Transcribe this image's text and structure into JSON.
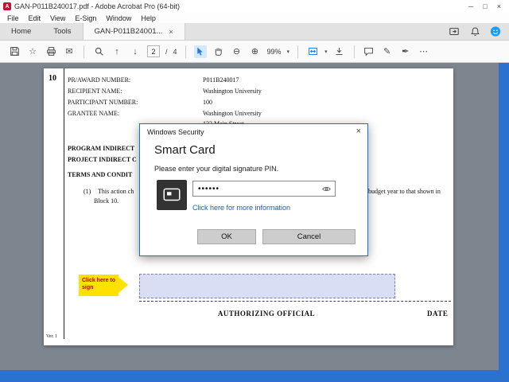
{
  "window": {
    "title": "GAN-P011B240017.pdf - Adobe Acrobat Pro (64-bit)",
    "app_icon_letter": "A",
    "minimize": "─",
    "maximize": "□",
    "close": "×"
  },
  "menubar": {
    "items": [
      "File",
      "Edit",
      "View",
      "E-Sign",
      "Window",
      "Help"
    ]
  },
  "tabbar": {
    "home": "Home",
    "tools": "Tools",
    "doc": "GAN-P011B24001...",
    "doc_close": "×"
  },
  "toolbar": {
    "star": "☆",
    "email": "✉",
    "page_up": "↑",
    "page_down": "↓",
    "page_current": "2",
    "page_separator": "/",
    "page_total": "4",
    "zoom_out": "⊖",
    "zoom_in": "⊕",
    "zoom_level": "99%",
    "caret": "▾",
    "highlighter": "✎",
    "pen": "✒",
    "more": "⋯"
  },
  "document": {
    "block_number": "10",
    "fields": [
      {
        "label": "PR/AWARD NUMBER:",
        "value": "P011B240017"
      },
      {
        "label": "RECIPIENT NAME:",
        "value": "Washington University"
      },
      {
        "label": "PARTICIPANT NUMBER:",
        "value": "100"
      },
      {
        "label": "GRANTEE NAME:",
        "value": "Washington University"
      }
    ],
    "grantee_address": "123 Main Street",
    "program_line": "PROGRAM INDIRECT",
    "project_line": "PROJECT INDIRECT C",
    "terms_line": "TERMS AND CONDIT",
    "clause_number": "(1)",
    "clause_text_left": "This action ch",
    "clause_text_right": "budget year to that shown in",
    "clause_text_line2": "Block 10.",
    "sign_callout": "Click here to sign",
    "authorizing_official": "AUTHORIZING OFFICIAL",
    "date": "DATE",
    "version": "Ver. 1"
  },
  "dialog": {
    "title": "Windows Security",
    "close": "×",
    "heading": "Smart Card",
    "prompt": "Please enter your digital signature PIN.",
    "pin_masked": "••••••",
    "info_link": "Click here for more information",
    "ok": "OK",
    "cancel": "Cancel"
  },
  "colors": {
    "dialog_border": "#0b76d1",
    "link_blue": "#0066cc",
    "accent_blue": "#2b72cf",
    "callout_yellow": "#ffe100",
    "callout_text_red": "#c00000",
    "signature_field": "#d9def5"
  }
}
